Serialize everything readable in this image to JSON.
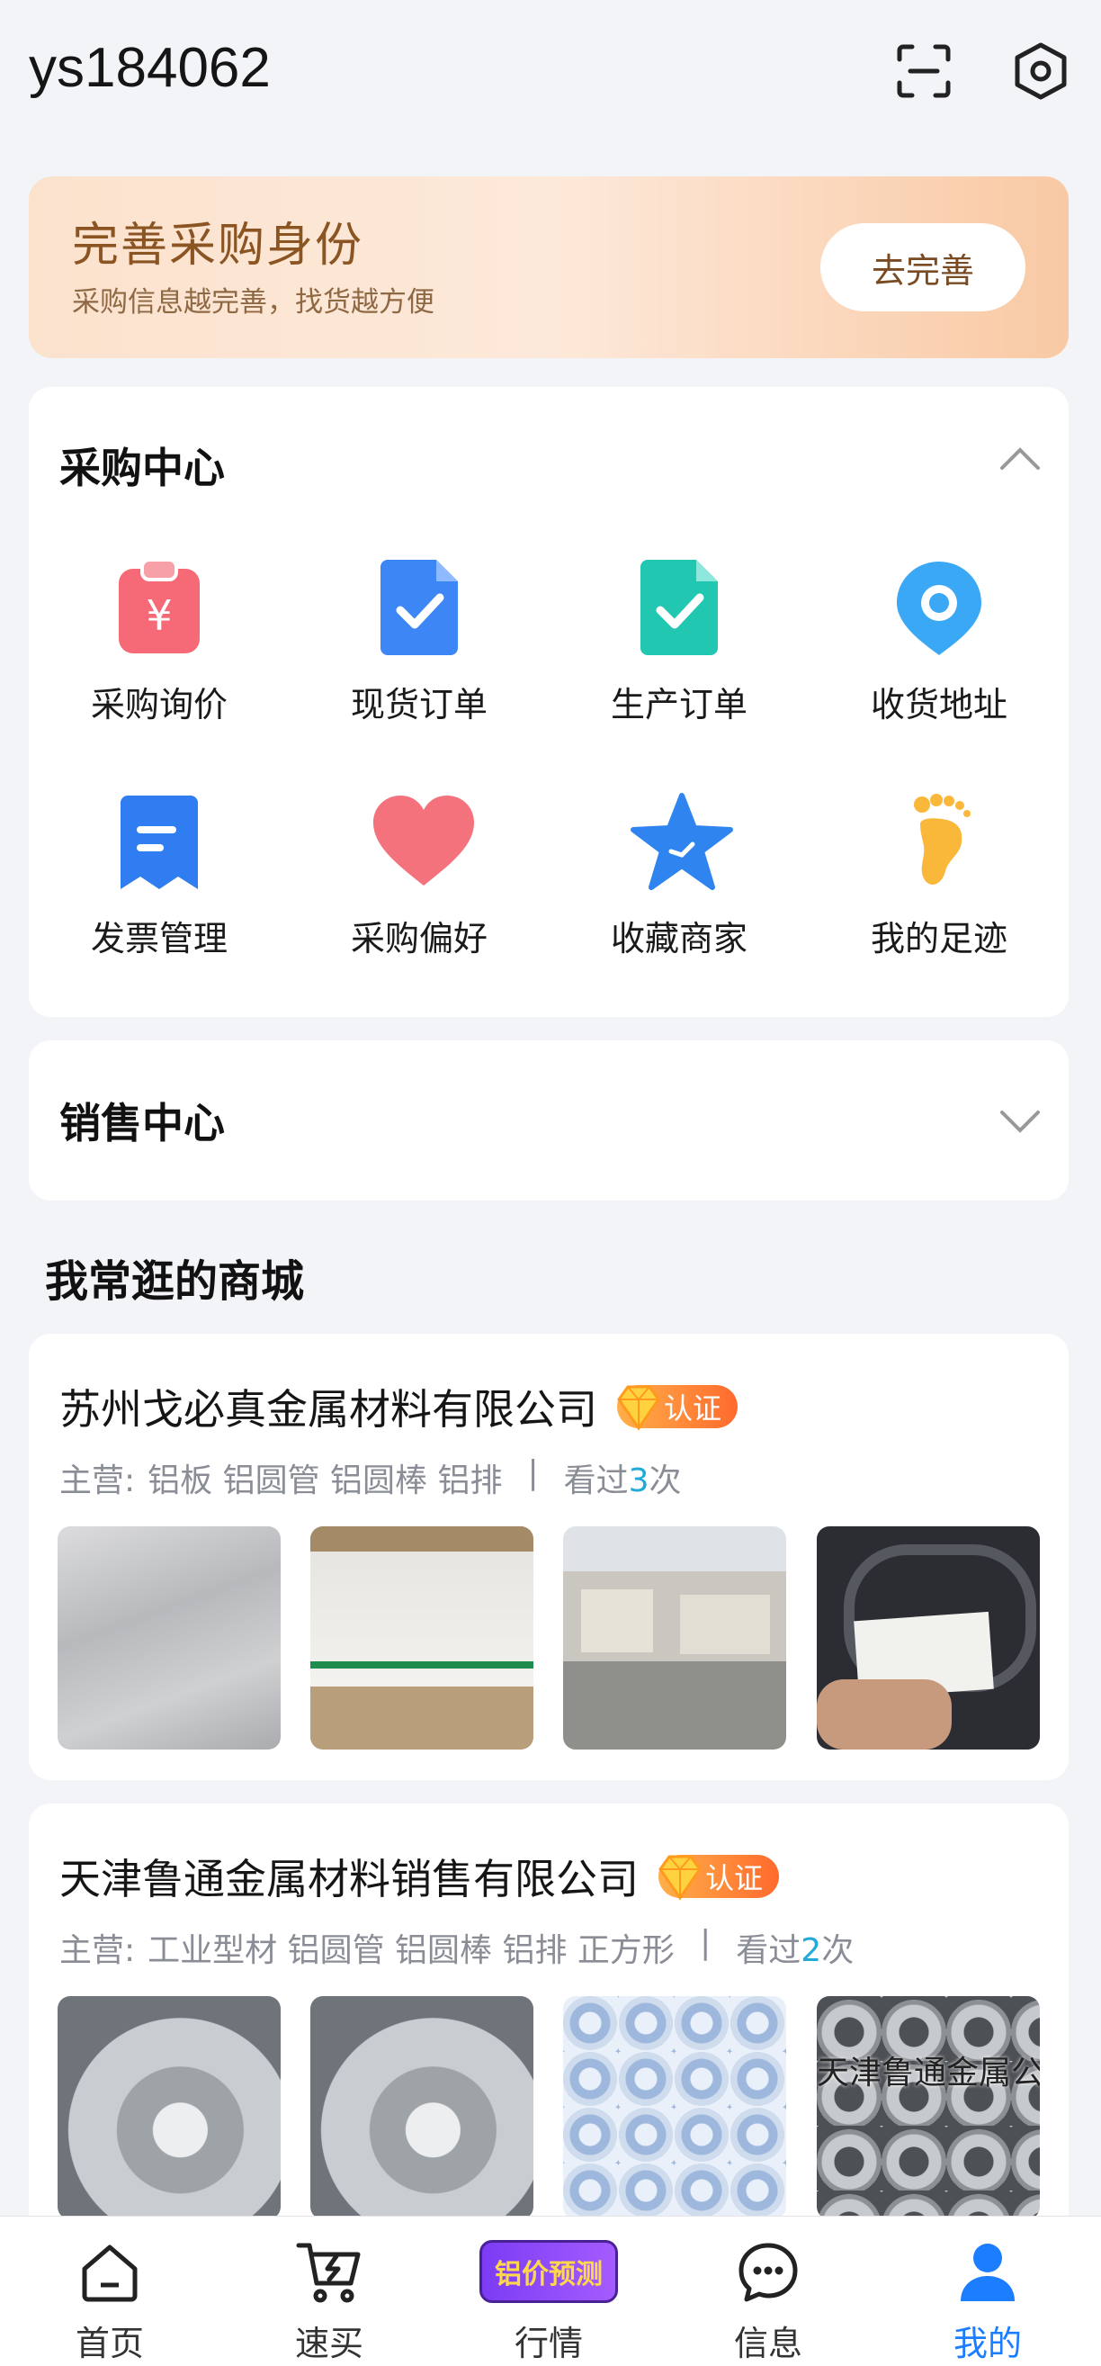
{
  "header": {
    "username": "ys184062",
    "scan_icon": "scan-icon",
    "settings_icon": "settings-hexagon-icon"
  },
  "banner": {
    "title": "完善采购身份",
    "subtitle": "采购信息越完善，找货越方便",
    "button": "去完善"
  },
  "purchase_center": {
    "title": "采购中心",
    "items": [
      {
        "label": "采购询价",
        "icon": "clipboard-yen-icon"
      },
      {
        "label": "现货订单",
        "icon": "doc-check-blue-icon"
      },
      {
        "label": "生产订单",
        "icon": "doc-check-teal-icon"
      },
      {
        "label": "收货地址",
        "icon": "location-pin-icon"
      },
      {
        "label": "发票管理",
        "icon": "invoice-icon"
      },
      {
        "label": "采购偏好",
        "icon": "heart-icon"
      },
      {
        "label": "收藏商家",
        "icon": "star-icon"
      },
      {
        "label": "我的足迹",
        "icon": "footprint-icon"
      }
    ]
  },
  "sales_center": {
    "title": "销售中心"
  },
  "frequent_shops": {
    "title": "我常逛的商城",
    "shops": [
      {
        "name": "苏州戈必真金属材料有限公司",
        "badge": "认证",
        "main_prefix": "主营:",
        "main_items": "铝板 铝圆管 铝圆棒 铝排",
        "divider": "|",
        "visited_prefix": "看过",
        "visited_count": "3",
        "visited_suffix": "次"
      },
      {
        "name": "天津鲁通金属材料销售有限公司",
        "badge": "认证",
        "main_prefix": "主营:",
        "main_items": "工业型材 铝圆管 铝圆棒 铝排 正方形管 矩",
        "divider": "|",
        "visited_prefix": "看过",
        "visited_count": "2",
        "visited_suffix": "次",
        "thumb_overlay_text": "天津鲁通金属公司"
      }
    ]
  },
  "tabbar": {
    "tabs": [
      {
        "label": "首页",
        "icon": "home-icon"
      },
      {
        "label": "速买",
        "icon": "cart-fast-icon"
      },
      {
        "label": "行情",
        "icon": "aluminum-price-badge-icon",
        "badge_text": "铝价预测"
      },
      {
        "label": "信息",
        "icon": "chat-bubble-icon"
      },
      {
        "label": "我的",
        "icon": "user-icon",
        "active": true
      }
    ]
  },
  "colors": {
    "accent": "#1c7dff",
    "badge_orange": "#ff7a2f",
    "banner_text": "#8b5523",
    "visited_count": "#21a9d8"
  }
}
